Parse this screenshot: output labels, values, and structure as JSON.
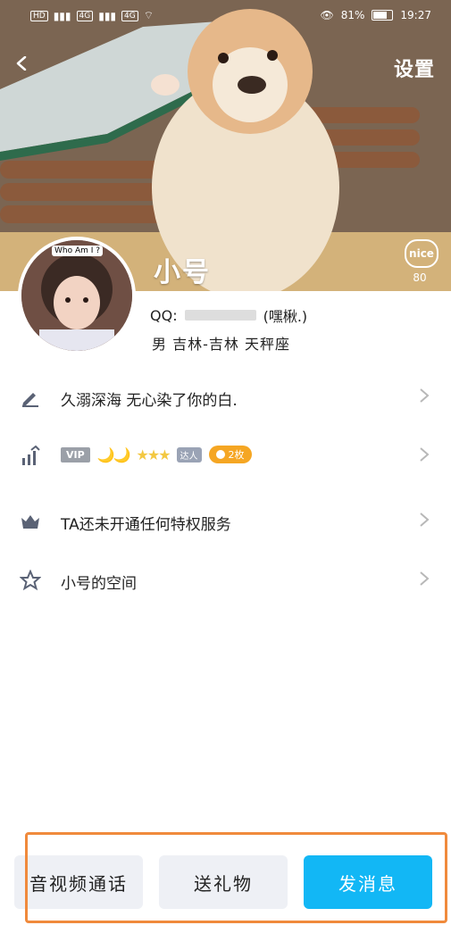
{
  "status_bar": {
    "left_badges": [
      "HD",
      "4G",
      "4G"
    ],
    "battery_text": "81%",
    "time": "19:27"
  },
  "header": {
    "back_icon": "chevron-left-icon",
    "settings_label": "设置"
  },
  "profile": {
    "nickname": "小号",
    "avatar_caption": "Who Am I ?",
    "qq_label": "QQ:",
    "qq_suffix": "(嘿楸.)",
    "bio": "男  吉林-吉林  天秤座",
    "nice_badge": "nice",
    "nice_count": "80"
  },
  "rows": [
    {
      "icon": "pencil-icon",
      "text": "久溺深海 无心染了你的白."
    },
    {
      "icon": "level-icon",
      "vip": "VIP",
      "moons": "🌙🌙",
      "stars": "★★★",
      "expert_label": "达人",
      "gold_label": "2枚"
    },
    {
      "icon": "crown-icon",
      "text": "TA还未开通任何特权服务"
    },
    {
      "icon": "star-icon",
      "text": "小号的空间"
    }
  ],
  "actions": {
    "call_label": "音视频通话",
    "gift_label": "送礼物",
    "message_label": "发消息"
  },
  "colors": {
    "accent": "#12b7f5",
    "highlight": "#f08a3c"
  }
}
